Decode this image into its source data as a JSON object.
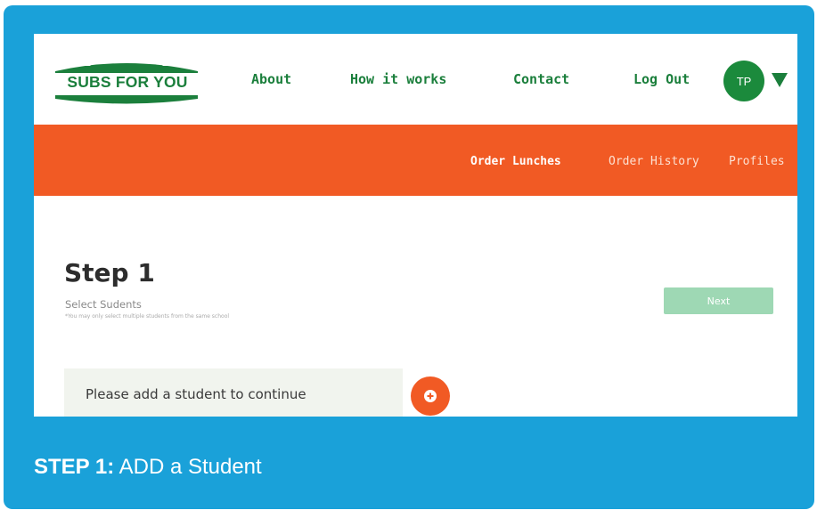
{
  "brand": {
    "logo_text": "SUBS FOR YOU",
    "color": "#1b7f3c"
  },
  "nav": {
    "about": "About",
    "how_it_works": "How it works",
    "contact": "Contact",
    "log_out": "Log Out",
    "avatar_initials": "TP",
    "dropdown_icon": "caret-down-icon"
  },
  "subnav": {
    "order_lunches": "Order Lunches",
    "order_history": "Order History",
    "profiles": "Profiles",
    "background_color": "#f15a24"
  },
  "step": {
    "title": "Step 1",
    "subtitle": "Select Sudents",
    "note": "*You may only select multiple students from the same school",
    "next_label": "Next",
    "empty_message": "Please add a student to continue",
    "add_icon": "plus-circle-icon"
  },
  "caption": {
    "strong": "STEP 1:",
    "text": "ADD a Student",
    "background_color": "#1aa1d9"
  }
}
